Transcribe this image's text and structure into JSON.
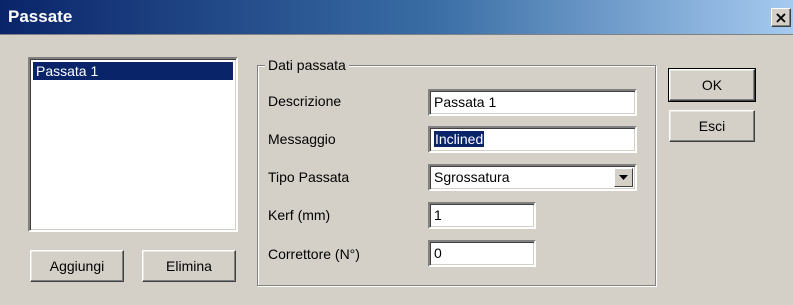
{
  "window": {
    "title": "Passate",
    "close_glyph": "×"
  },
  "list": {
    "items": [
      {
        "label": "Passata 1",
        "selected": true
      }
    ]
  },
  "buttons": {
    "add": "Aggiungi",
    "delete": "Elimina",
    "ok": "OK",
    "exit": "Esci"
  },
  "group": {
    "legend": "Dati passata",
    "description": {
      "label": "Descrizione",
      "value": "Passata 1"
    },
    "message": {
      "label": "Messaggio",
      "value": "Inclined"
    },
    "pass_type": {
      "label": "Tipo Passata",
      "value": "Sgrossatura"
    },
    "kerf": {
      "label": "Kerf (mm)",
      "value": "1"
    },
    "corrector": {
      "label": "Correttore (N°)",
      "value": "0"
    }
  },
  "colors": {
    "selection": "#0a246a",
    "face": "#d4d0c8"
  }
}
